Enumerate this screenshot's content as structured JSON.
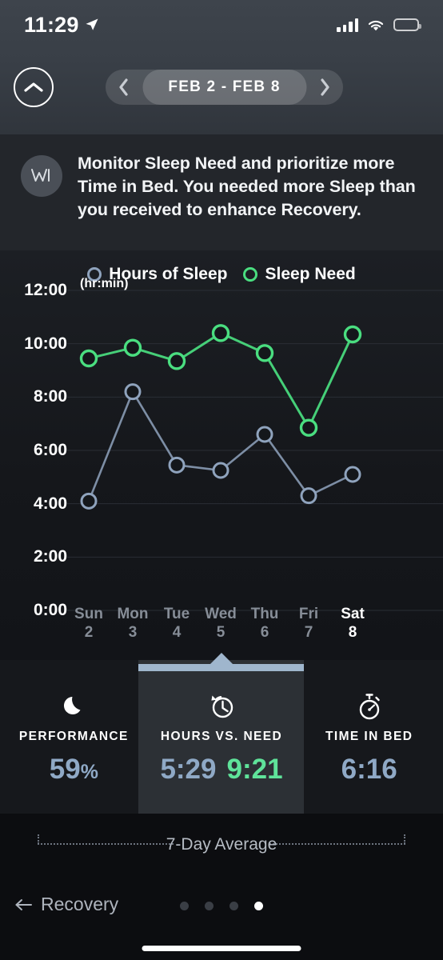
{
  "status_bar": {
    "time": "11:29",
    "location_icon": "location-arrow-icon",
    "signal_icon": "cellular-signal-icon",
    "wifi_icon": "wifi-icon",
    "battery_icon": "battery-low-icon",
    "battery_color": "#f5d020"
  },
  "nav": {
    "collapse_icon": "chevron-up-icon",
    "prev_icon": "chevron-left-icon",
    "next_icon": "chevron-right-icon",
    "week_label": "FEB 2 - FEB 8"
  },
  "banner": {
    "icon": "whoop-logo-icon",
    "text": "Monitor Sleep Need and prioritize more Time in Bed. You needed more Sleep than you received to enhance Recovery."
  },
  "chart_data": {
    "type": "line",
    "title": "",
    "xlabel": "",
    "ylabel": "(hr:min)",
    "axis_unit": "(hr:min)",
    "ylim": [
      0,
      12
    ],
    "ytick_labels": [
      "12:00",
      "10:00",
      "8:00",
      "6:00",
      "4:00",
      "2:00",
      "0:00"
    ],
    "ytick_values": [
      12,
      10,
      8,
      6,
      4,
      2,
      0
    ],
    "grid": true,
    "legend_position": "top-center",
    "categories": [
      "Sun",
      "Mon",
      "Tue",
      "Wed",
      "Thu",
      "Fri",
      "Sat"
    ],
    "x_day_numbers": [
      "2",
      "3",
      "4",
      "5",
      "6",
      "7",
      "8"
    ],
    "x_active_index": 6,
    "series": [
      {
        "name": "Hours of Sleep",
        "color": "#8fa3bd",
        "values": [
          4.1,
          8.2,
          5.45,
          5.25,
          6.6,
          4.3,
          5.1
        ]
      },
      {
        "name": "Sleep Need",
        "color": "#4ade80",
        "values": [
          9.45,
          9.85,
          9.35,
          10.4,
          9.65,
          6.85,
          10.35
        ]
      }
    ]
  },
  "stats": {
    "highlight_index": 1,
    "items": [
      {
        "icon": "moon-icon",
        "title": "PERFORMANCE",
        "value": "59",
        "suffix": "%",
        "value2": ""
      },
      {
        "icon": "clock-arrow-icon",
        "title": "HOURS VS. NEED",
        "value": "5:29",
        "suffix": "",
        "value2": "9:21"
      },
      {
        "icon": "stopwatch-icon",
        "title": "TIME IN BED",
        "value": "6:16",
        "suffix": "",
        "value2": ""
      }
    ]
  },
  "average": {
    "label": "7-Day Average"
  },
  "footer": {
    "back_icon": "arrow-left-icon",
    "back_label": "Recovery",
    "page_dots": 4,
    "active_dot": 3
  },
  "colors": {
    "sleep_hours": "#8fa3bd",
    "sleep_need": "#4ade80",
    "value_blue": "#8fa9c6",
    "value_green": "#5fe39a",
    "highlight_bar": "#9fb6cd"
  }
}
